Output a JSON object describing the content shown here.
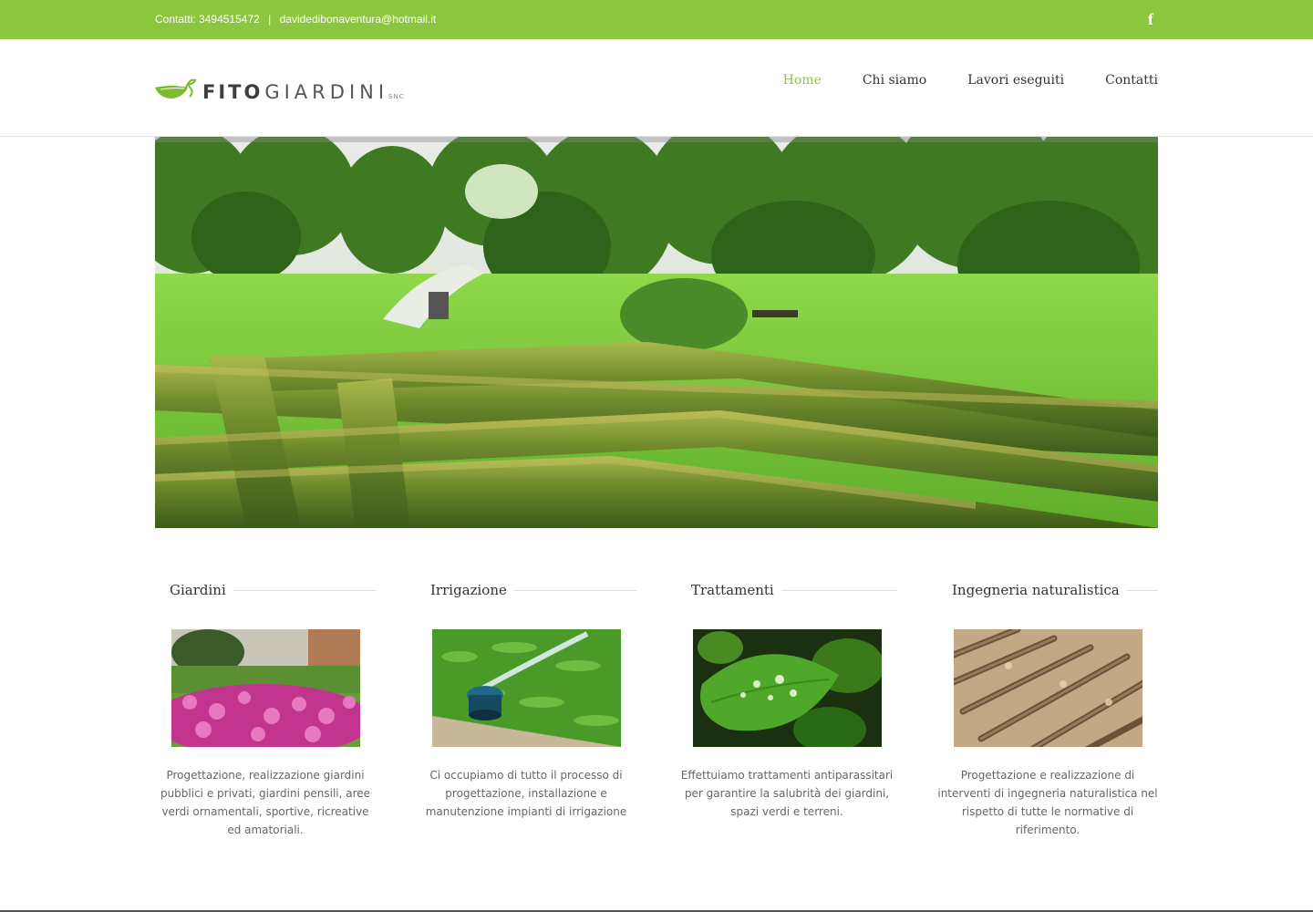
{
  "topbar": {
    "contact_label": "Contatti:",
    "phone": "3494515472",
    "separator": "|",
    "email": "davidedibonaventura@hotmail.it",
    "facebook_icon": "facebook-icon"
  },
  "brand": {
    "name_bold": "FITO",
    "name_light": "GIARDINI",
    "suffix": "SNC",
    "accent_color": "#8cc63f"
  },
  "nav": {
    "items": [
      {
        "label": "Home",
        "active": true
      },
      {
        "label": "Chi siamo",
        "active": false
      },
      {
        "label": "Lavori eseguiti",
        "active": false
      },
      {
        "label": "Contatti",
        "active": false
      }
    ]
  },
  "services": [
    {
      "title": "Giardini",
      "description": "Progettazione, realizzazione giardini pubblici e privati, giardini pensili, aree verdi ornamentali, sportive, ricreative ed amatoriali."
    },
    {
      "title": "Irrigazione",
      "description": "Ci occupiamo di tutto il processo di progettazione, installazione e manutenzione impianti di irrigazione"
    },
    {
      "title": "Trattamenti",
      "description": "Effettuiamo trattamenti antiparassitari per garantire la salubrità dei giardini, spazi verdi e terreni."
    },
    {
      "title": "Ingegneria naturalistica",
      "description": "Progettazione e realizzazione di interventi di ingegneria naturalistica nel rispetto di tutte le normative di riferimento."
    }
  ]
}
